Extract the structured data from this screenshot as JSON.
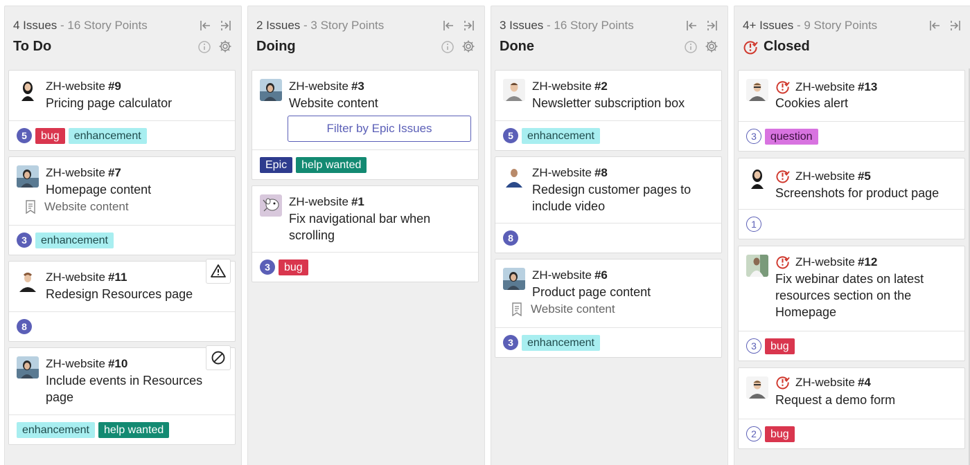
{
  "columns": [
    {
      "summary_count": "4 Issues",
      "summary_points": " - 16 Story Points",
      "title": "To Do",
      "cards": [
        {
          "repo": "ZH-website",
          "number": "#9",
          "title": "Pricing page calculator",
          "estimate": "5",
          "labels": [
            "bug",
            "enhancement"
          ]
        },
        {
          "repo": "ZH-website",
          "number": "#7",
          "title": "Homepage content",
          "epic": "Website content",
          "estimate": "3",
          "labels": [
            "enhancement"
          ]
        },
        {
          "repo": "ZH-website",
          "number": "#11",
          "title": "Redesign Resources page",
          "estimate": "8",
          "labels": []
        },
        {
          "repo": "ZH-website",
          "number": "#10",
          "title": "Include events in Resources page",
          "labels": [
            "enhancement",
            "help wanted"
          ]
        }
      ]
    },
    {
      "summary_count": "2 Issues",
      "summary_points": " - 3 Story Points",
      "title": "Doing",
      "cards": [
        {
          "repo": "ZH-website",
          "number": "#3",
          "title": "Website content",
          "button": "Filter by Epic Issues",
          "labels": [
            "Epic",
            "help wanted"
          ]
        },
        {
          "repo": "ZH-website",
          "number": "#1",
          "title": "Fix navigational bar when scrolling",
          "estimate": "3",
          "labels": [
            "bug"
          ]
        }
      ]
    },
    {
      "summary_count": "3 Issues",
      "summary_points": " - 16 Story Points",
      "title": "Done",
      "cards": [
        {
          "repo": "ZH-website",
          "number": "#2",
          "title": "Newsletter subscription box",
          "estimate": "5",
          "labels": [
            "enhancement"
          ]
        },
        {
          "repo": "ZH-website",
          "number": "#8",
          "title": "Redesign customer pages to include video",
          "estimate": "8",
          "labels": []
        },
        {
          "repo": "ZH-website",
          "number": "#6",
          "title": "Product page content",
          "epic": "Website content",
          "estimate": "3",
          "labels": [
            "enhancement"
          ]
        }
      ]
    },
    {
      "summary_count": "4+ Issues",
      "summary_points": " - 9 Story Points",
      "title": "Closed",
      "cards": [
        {
          "repo": "ZH-website",
          "number": "#13",
          "title": "Cookies alert",
          "estimate": "3",
          "labels": [
            "question"
          ]
        },
        {
          "repo": "ZH-website",
          "number": "#5",
          "title": "Screenshots for product page",
          "estimate": "1",
          "labels": []
        },
        {
          "repo": "ZH-website",
          "number": "#12",
          "title": "Fix webinar dates on latest resources section on the Homepage",
          "estimate": "3",
          "labels": [
            "bug"
          ]
        },
        {
          "repo": "ZH-website",
          "number": "#4",
          "title": "Request a demo form",
          "estimate": "2",
          "labels": [
            "bug"
          ]
        }
      ]
    }
  ],
  "colors": {
    "accent": "#5b5fb7",
    "bug": "#d9364e",
    "enhancement": "#a8eef0",
    "help_wanted": "#138a72",
    "epic": "#2e3c8e",
    "question": "#d873e0",
    "closed": "#d0392e"
  },
  "icons": [
    "collapse-left-icon",
    "collapse-right-icon",
    "info-icon",
    "gear-icon",
    "closed-issue-icon",
    "epic-icon",
    "warning-icon",
    "blocked-icon"
  ]
}
